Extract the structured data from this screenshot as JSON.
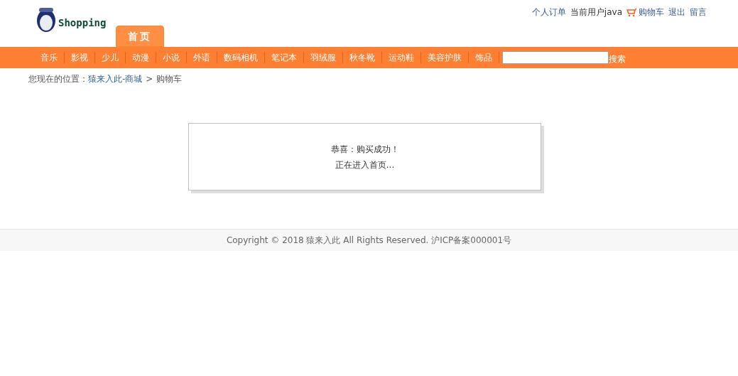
{
  "logo": {
    "text": "Shopping"
  },
  "top_links": [
    {
      "kind": "link",
      "text": "个人订单"
    },
    {
      "kind": "user",
      "text": "当前用户java"
    },
    {
      "kind": "cart",
      "text": "购物车"
    },
    {
      "kind": "link",
      "text": "退出"
    },
    {
      "kind": "link",
      "text": "留言"
    }
  ],
  "tabs": [
    {
      "label": "首页",
      "selected": true
    }
  ],
  "categories": [
    "音乐",
    "影视",
    "少儿",
    "动漫",
    "小说",
    "外语",
    "数码相机",
    "笔记本",
    "羽绒服",
    "秋冬靴",
    "运动鞋",
    "美容护肤",
    "饰品"
  ],
  "search": {
    "button": "搜索"
  },
  "breadcrumb": {
    "label": "您现在的位置：",
    "items": [
      {
        "text": "猿来入此-商城",
        "link": true
      },
      {
        "text": ">",
        "link": false
      },
      {
        "text": "购物车",
        "link": false
      }
    ]
  },
  "message": {
    "lines": [
      "恭喜：购买成功！",
      "正在进入首页..."
    ]
  },
  "footer": "Copyright © 2018 猿来入此 All Rights Reserved. 沪ICP备案000001号"
}
